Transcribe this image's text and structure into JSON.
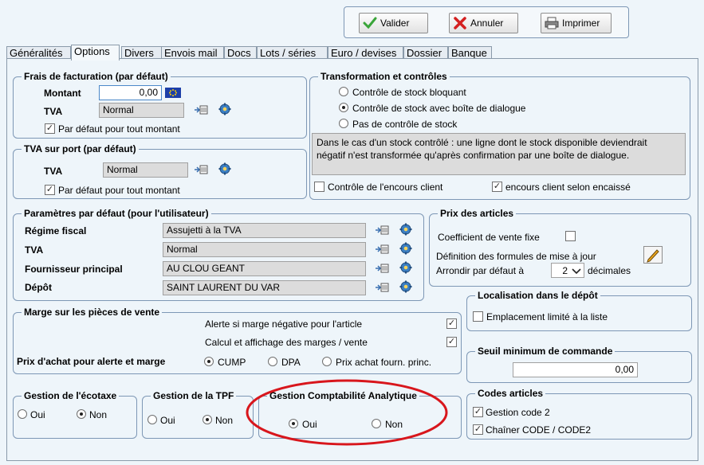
{
  "toolbar": {
    "validate_label": "Valider",
    "cancel_label": "Annuler",
    "print_label": "Imprimer"
  },
  "tabs": [
    "Généralités",
    "Options",
    "Divers",
    "Envois mail",
    "Docs",
    "Lots / séries",
    "Euro / devises",
    "Dossier",
    "Banque"
  ],
  "active_tab": "Options",
  "billing_fees": {
    "title": "Frais de facturation (par défaut)",
    "amount_label": "Montant",
    "amount_value": "0,00",
    "tva_label": "TVA",
    "tva_value": "Normal",
    "default_all_label": "Par défaut pour tout montant",
    "default_all_checked": true
  },
  "shipping_tva": {
    "title": "TVA sur port (par défaut)",
    "tva_label": "TVA",
    "tva_value": "Normal",
    "default_all_label": "Par défaut pour tout montant",
    "default_all_checked": true
  },
  "transformation": {
    "title": "Transformation et contrôles",
    "options": [
      "Contrôle de stock bloquant",
      "Contrôle de stock avec boîte de dialogue",
      "Pas de contrôle de stock"
    ],
    "selected_index": 1,
    "info_line1": "Dans le cas d'un stock contrôlé : une ligne dont le stock disponible deviendrait",
    "info_line2": "négatif n'est transformée qu'après confirmation par une boîte de dialogue.",
    "outstanding_control_label": "Contrôle de l'encours client",
    "outstanding_control_checked": false,
    "outstanding_cashed_label": "encours client selon encaissé",
    "outstanding_cashed_checked": true
  },
  "user_defaults": {
    "title": "Paramètres par défaut (pour l'utilisateur)",
    "rows": [
      {
        "label": "Régime fiscal",
        "value": "Assujetti à la TVA"
      },
      {
        "label": "TVA",
        "value": "Normal"
      },
      {
        "label": "Fournisseur principal",
        "value": "AU CLOU GEANT"
      },
      {
        "label": "Dépôt",
        "value": "SAINT LAURENT DU VAR"
      }
    ]
  },
  "article_prices": {
    "title": "Prix des articles",
    "coef_label": "Coefficient de vente fixe",
    "coef_checked": false,
    "formula_label": "Définition des formules de mise à jour",
    "round_label": "Arrondir par défaut à",
    "round_value": "2",
    "decimals_label": "décimales"
  },
  "sales_margin": {
    "title": "Marge sur les pièces de vente",
    "alert_negative_label": "Alerte si marge négative pour l'article",
    "alert_negative_checked": true,
    "calc_display_label": "Calcul et affichage des marges / vente",
    "calc_display_checked": true,
    "purchase_price_label": "Prix d'achat pour alerte et marge",
    "options": [
      "CUMP",
      "DPA",
      "Prix achat fourn. princ."
    ],
    "selected_index": 0
  },
  "depot_location": {
    "title": "Localisation dans le dépôt",
    "limited_label": "Emplacement limité à la liste",
    "limited_checked": false
  },
  "min_order": {
    "title": "Seuil minimum de commande",
    "value": "0,00"
  },
  "ecotax": {
    "title": "Gestion de l'écotaxe",
    "yes": "Oui",
    "no": "Non",
    "selected": "no"
  },
  "tpf": {
    "title": "Gestion de la TPF",
    "yes": "Oui",
    "no": "Non",
    "selected": "no"
  },
  "analytics": {
    "title": "Gestion Comptabilité Analytique",
    "yes": "Oui",
    "no": "Non",
    "selected": "yes"
  },
  "article_codes": {
    "title": "Codes articles",
    "code2_label": "Gestion code 2",
    "code2_checked": true,
    "chain_label": "Chaîner CODE / CODE2",
    "chain_checked": true
  },
  "colors": {
    "highlight_ellipse": "#d8161c",
    "frame_border": "#7d97b5"
  }
}
